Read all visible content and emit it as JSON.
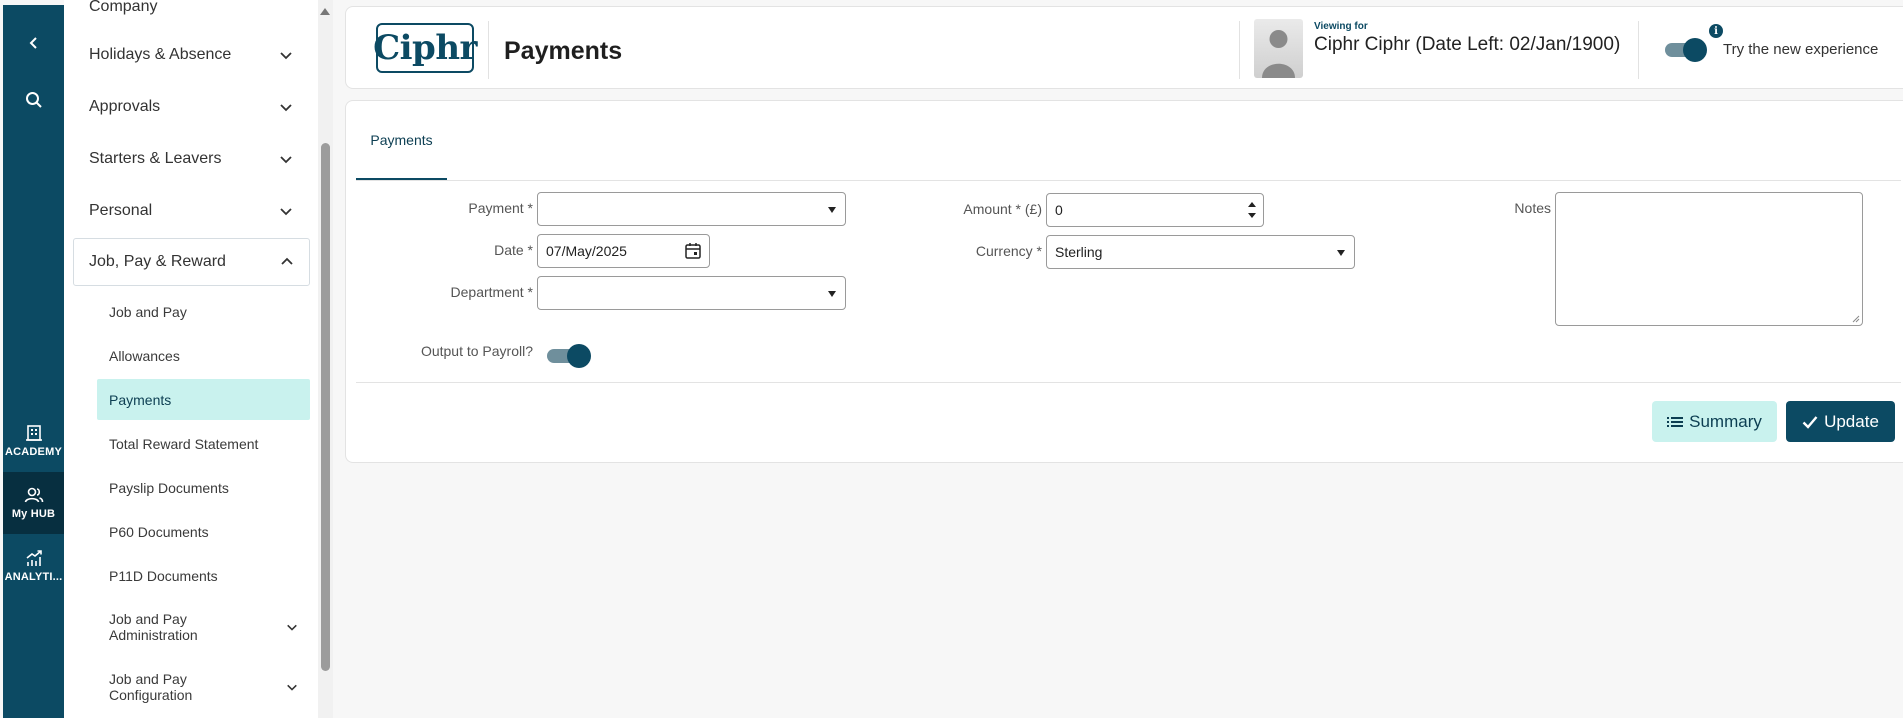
{
  "rail": {
    "academy_label": "ACADEMY",
    "myhub_label": "My HUB",
    "analytics_label": "ANALYTI..."
  },
  "nav": {
    "partial_top": "Company",
    "sections": [
      {
        "label": "Holidays & Absence"
      },
      {
        "label": "Approvals"
      },
      {
        "label": "Starters & Leavers"
      },
      {
        "label": "Personal"
      },
      {
        "label": "Job, Pay & Reward"
      }
    ],
    "items": [
      {
        "label": "Job and Pay"
      },
      {
        "label": "Allowances"
      },
      {
        "label": "Payments"
      },
      {
        "label": "Total Reward Statement"
      },
      {
        "label": "Payslip Documents"
      },
      {
        "label": "P60 Documents"
      },
      {
        "label": "P11D Documents"
      },
      {
        "label": "Job and Pay Administration"
      },
      {
        "label": "Job and Pay Configuration"
      }
    ]
  },
  "header": {
    "logo_text": "Ciphr",
    "title": "Payments",
    "viewing_for_label": "Viewing for",
    "viewing_name": "Ciphr Ciphr (Date Left: 02/Jan/1900)",
    "new_experience_label": "Try the new experience",
    "new_experience_on": true
  },
  "form": {
    "tab_label": "Payments",
    "payment_label": "Payment *",
    "payment_value": "",
    "date_label": "Date *",
    "date_value": "07/May/2025",
    "department_label": "Department *",
    "department_value": "",
    "amount_label": "Amount * (£)",
    "amount_value": "0",
    "currency_label": "Currency *",
    "currency_value": "Sterling",
    "notes_label": "Notes",
    "notes_value": "",
    "output_payroll_label": "Output to Payroll?",
    "output_payroll_on": true,
    "summary_label": "Summary",
    "update_label": "Update"
  },
  "colors": {
    "brand": "#0c4a63",
    "active_bg": "#c9f2ee"
  }
}
